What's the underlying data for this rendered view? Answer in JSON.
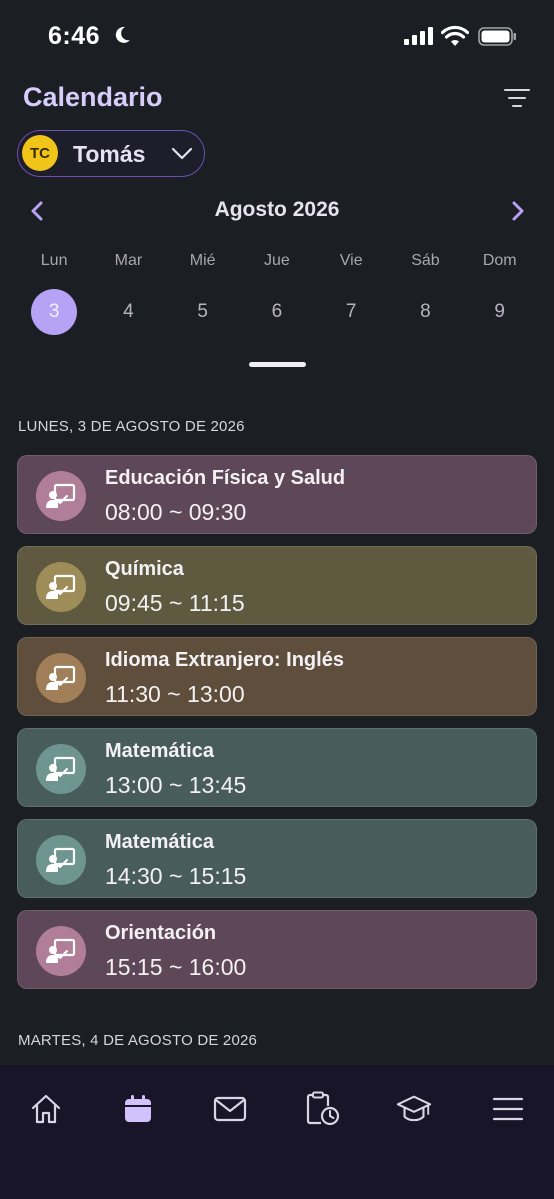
{
  "status_bar": {
    "time": "6:46"
  },
  "header": {
    "title": "Calendario"
  },
  "student": {
    "initials": "TC",
    "name": "Tomás",
    "avatar_color": "#f0c419"
  },
  "calendar": {
    "month": "Agosto 2026",
    "weekdays": [
      "Lun",
      "Mar",
      "Mié",
      "Jue",
      "Vie",
      "Sáb",
      "Dom"
    ],
    "days": [
      "3",
      "4",
      "5",
      "6",
      "7",
      "8",
      "9"
    ],
    "selected_day": "3",
    "accent": "#b7a2f5"
  },
  "sections": [
    {
      "heading": "LUNES, 3 DE AGOSTO DE 2026"
    },
    {
      "heading": "MARTES, 4 DE AGOSTO DE 2026"
    }
  ],
  "events": [
    {
      "name": "Educación Física y Salud",
      "time": "08:00 ~ 09:30",
      "color": "#5e4758",
      "icon_color": "#b07e98",
      "icon": "class-icon"
    },
    {
      "name": "Química",
      "time": "09:45 ~ 11:15",
      "color": "#5f5940",
      "icon_color": "#9e8d58",
      "icon": "class-icon"
    },
    {
      "name": "Idioma Extranjero: Inglés",
      "time": "11:30 ~ 13:00",
      "color": "#5e4e3b",
      "icon_color": "#a07e57",
      "icon": "class-icon"
    },
    {
      "name": "Matemática",
      "time": "13:00 ~ 13:45",
      "color": "#485c5c",
      "icon_color": "#6e9590",
      "icon": "class-icon"
    },
    {
      "name": "Matemática",
      "time": "14:30 ~ 15:15",
      "color": "#485c5c",
      "icon_color": "#6e9590",
      "icon": "class-icon"
    },
    {
      "name": "Orientación",
      "time": "15:15 ~ 16:00",
      "color": "#5e4758",
      "icon_color": "#b07e98",
      "icon": "class-icon"
    }
  ],
  "bottom_nav": [
    {
      "icon": "home-icon"
    },
    {
      "icon": "calendar-icon",
      "active": true
    },
    {
      "icon": "mail-icon"
    },
    {
      "icon": "clipboard-clock-icon"
    },
    {
      "icon": "graduation-cap-icon"
    },
    {
      "icon": "menu-icon"
    }
  ]
}
